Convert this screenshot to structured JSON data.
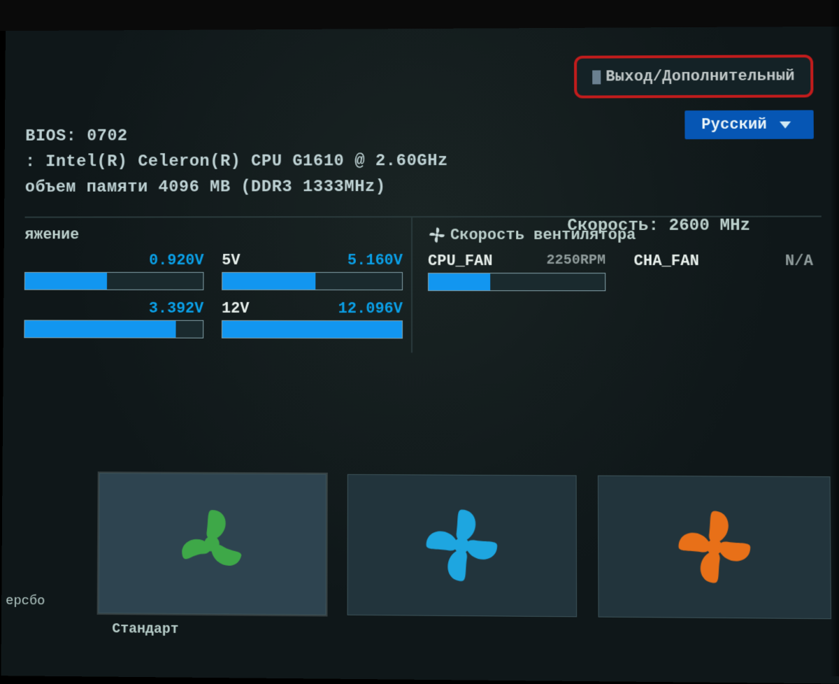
{
  "header": {
    "exit_label": "Выход/Дополнительный",
    "language": "Русский"
  },
  "sysinfo": {
    "bios_line": "BIOS: 0702",
    "cpu_line": ": Intel(R) Celeron(R) CPU G1610 @ 2.60GHz",
    "memory_line": "объем памяти 4096 MB (DDR3 1333MHz)",
    "speed_line": "Скорость: 2600 MHz"
  },
  "voltage": {
    "title": "яжение",
    "items": [
      {
        "label": "",
        "value": "0.920V",
        "fill": 46
      },
      {
        "label": "5V",
        "value": "5.160V",
        "fill": 52
      },
      {
        "label": "",
        "value": "3.392V",
        "fill": 85
      },
      {
        "label": "12V",
        "value": "12.096V",
        "fill": 100
      }
    ]
  },
  "fanspeed": {
    "title": "Скорость вентилятора",
    "items": [
      {
        "label": "CPU_FAN",
        "value": "2250RPM",
        "fill": 35
      },
      {
        "label": "CHA_FAN",
        "value": "N/A",
        "fill": 0
      }
    ]
  },
  "modes": {
    "sidebar_label": "ерсбо",
    "active_label": "Стандарт",
    "colors": {
      "green": "#3ea848",
      "blue": "#1ea6e0",
      "orange": "#e87018"
    }
  }
}
